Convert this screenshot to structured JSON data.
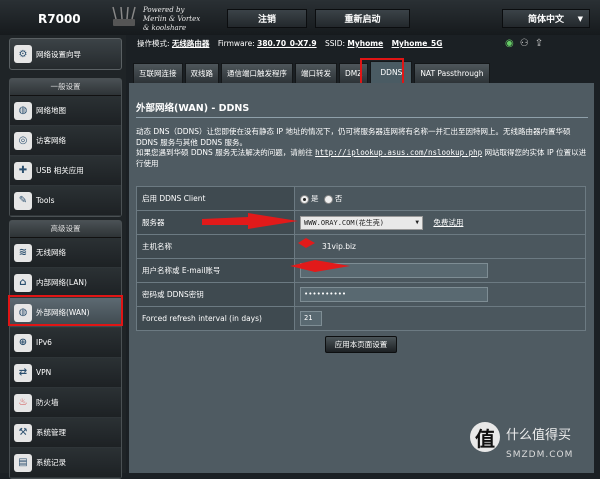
{
  "header": {
    "model": "R7000",
    "tagline_1": "Powered by",
    "tagline_2": "Merlin & Vortex",
    "tagline_3": "& koolshare",
    "logout_label": "注销",
    "reboot_label": "重新启动",
    "language_label": "简体中文"
  },
  "status": {
    "mode_label": "操作模式:",
    "mode_value": "无线路由器",
    "firmware_label": "Firmware:",
    "firmware_value": "380.70_0-X7.9",
    "ssid_label": "SSID:",
    "ssid_1": "Myhome",
    "ssid_2": "Myhome_5G"
  },
  "sidebar": {
    "quick_setup": "网络设置向导",
    "general_title": "一般设置",
    "general_items": [
      "网络地图",
      "访客网络",
      "USB 相关应用",
      "Tools"
    ],
    "advanced_title": "高级设置",
    "advanced_items": [
      "无线网络",
      "内部网络(LAN)",
      "外部网络(WAN)",
      "IPv6",
      "VPN",
      "防火墙",
      "系统管理",
      "系统记录"
    ]
  },
  "tabs": [
    "互联网连接",
    "双线路",
    "通信端口触发程序",
    "端口转发",
    "DMZ",
    "DDNS",
    "NAT Passthrough"
  ],
  "main": {
    "title": "外部网络(WAN) - DDNS",
    "desc_1": "动态 DNS（DDNS）让您即使在没有静态 IP 地址的情况下，仍可将服务器连网将有名称一并汇出至因特网上。无线路由器内置华硕 DDNS 服务与其他 DDNS 服务。",
    "desc_2": "如果您遇到华硕 DDNS 服务无法解决的问题，请前往",
    "desc_link": "http://iplookup.asus.com/nslookup.php",
    "desc_3": "网站取得您的实体 IP 位置以进行使用",
    "apply_label": "应用本页面设置"
  },
  "form": {
    "enable_label": "启用 DDNS Client",
    "yes_label": "是",
    "no_label": "否",
    "server_label": "服务器",
    "server_value": "WWW.ORAY.COM(花生壳)",
    "free_trial": "免费试用",
    "host_label": "主机名称",
    "host_value": "31vip.biz",
    "user_label": "用户名称或 E-mail账号",
    "pass_label": "密码或 DDNS密钥",
    "pass_value": "••••••••••",
    "interval_label": "Forced refresh interval (in days)",
    "interval_value": "21"
  },
  "watermark": {
    "glyph": "值",
    "text": "什么值得买",
    "domain": "SMZDM.COM"
  }
}
